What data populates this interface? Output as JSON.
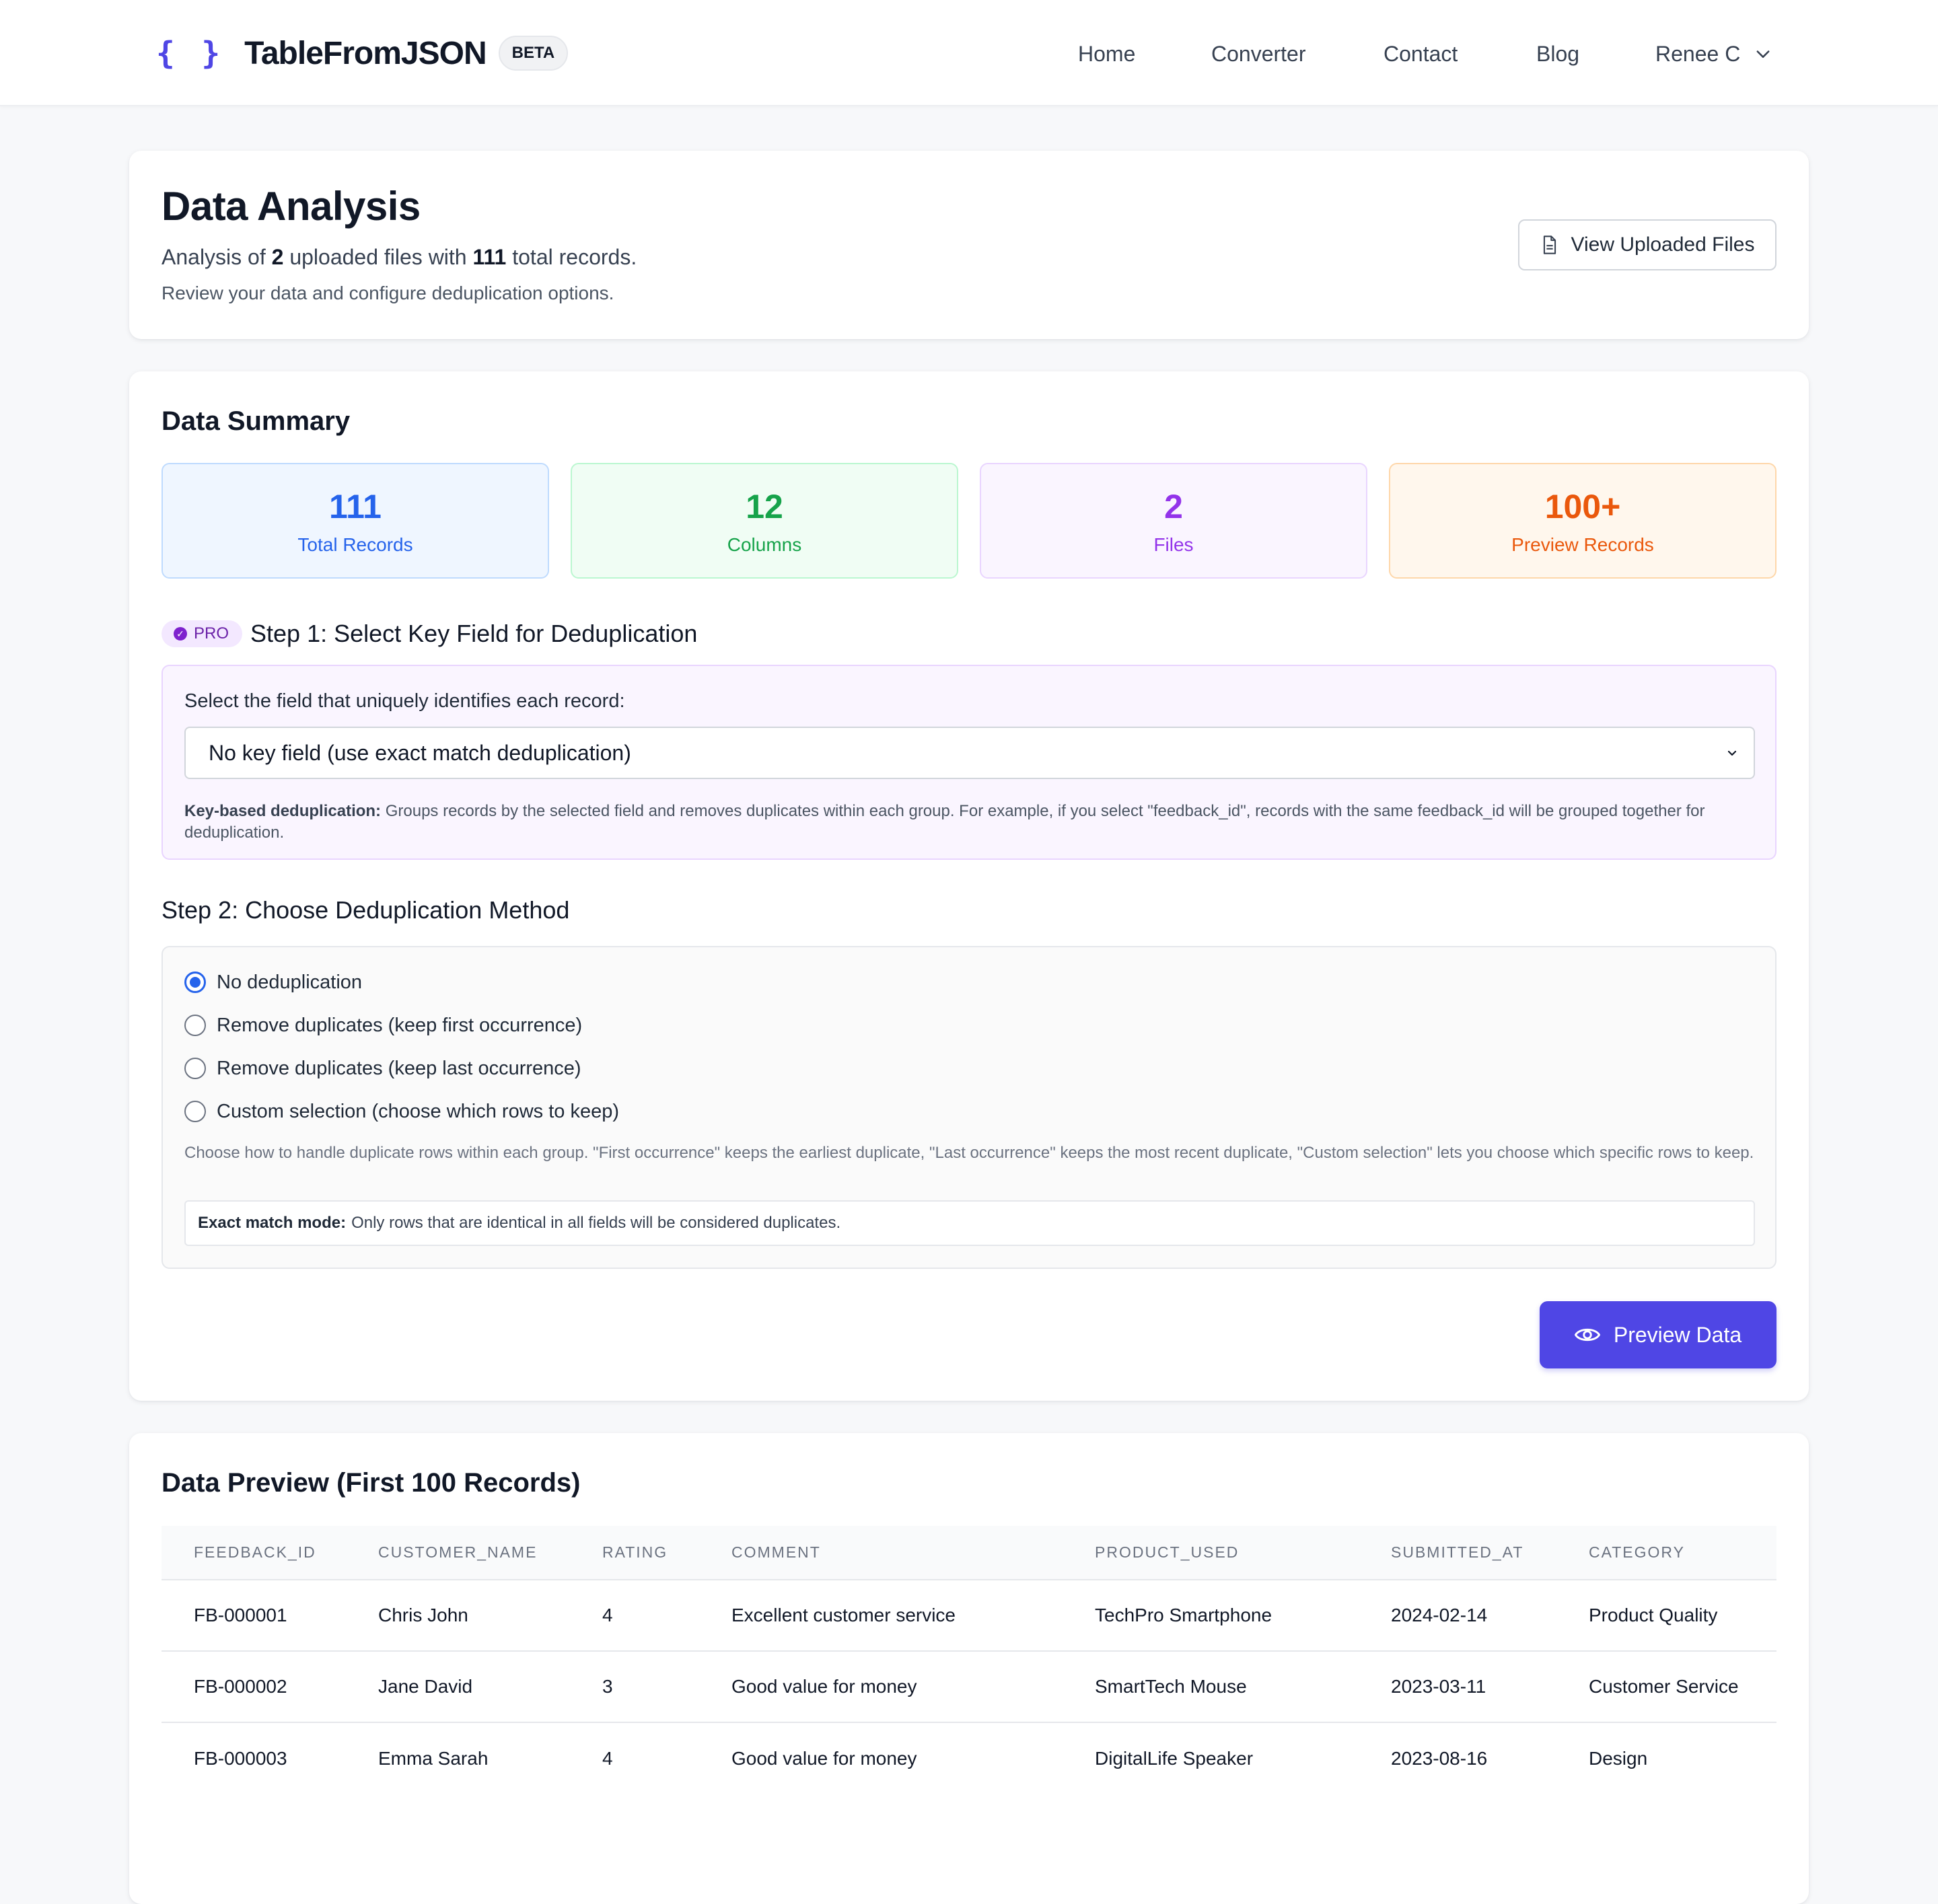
{
  "nav": {
    "logo_glyph": "{ }",
    "brand": "TableFromJSON",
    "badge": "BETA",
    "links": [
      "Home",
      "Converter",
      "Contact",
      "Blog"
    ],
    "user": "Renee C"
  },
  "header": {
    "title": "Data Analysis",
    "sub_prefix": "Analysis of ",
    "files_count": "2",
    "sub_mid": " uploaded files with ",
    "records_count": "111",
    "sub_suffix": " total records.",
    "note": "Review your data and configure deduplication options.",
    "view_files_label": "View Uploaded Files"
  },
  "summary": {
    "title": "Data Summary",
    "stats": [
      {
        "value": "111",
        "label": "Total Records",
        "color": "#2563eb",
        "bg": "#eff6ff",
        "border": "#bfdbfe"
      },
      {
        "value": "12",
        "label": "Columns",
        "color": "#16a34a",
        "bg": "#f0fdf4",
        "border": "#bbf7d0"
      },
      {
        "value": "2",
        "label": "Files",
        "color": "#9333ea",
        "bg": "#faf5ff",
        "border": "#e9d5ff"
      },
      {
        "value": "100+",
        "label": "Preview Records",
        "color": "#ea580c",
        "bg": "#fff7ed",
        "border": "#fed7aa"
      }
    ]
  },
  "step1": {
    "pro_label": "PRO",
    "title": "Step 1: Select Key Field for Deduplication",
    "field_label": "Select the field that uniquely identifies each record:",
    "selected": "No key field (use exact match deduplication)",
    "hint_bold": "Key-based deduplication:",
    "hint_text": " Groups records by the selected field and removes duplicates within each group. For example, if you select \"feedback_id\", records with the same feedback_id will be grouped together for deduplication."
  },
  "step2": {
    "title": "Step 2: Choose Deduplication Method",
    "options": [
      "No deduplication",
      "Remove duplicates (keep first occurrence)",
      "Remove duplicates (keep last occurrence)",
      "Custom selection (choose which rows to keep)"
    ],
    "selected_index": 0,
    "hint": "Choose how to handle duplicate rows within each group. \"First occurrence\" keeps the earliest duplicate, \"Last occurrence\" keeps the most recent duplicate, \"Custom selection\" lets you choose which specific rows to keep.",
    "exact_bold": "Exact match mode:",
    "exact_text": "Only rows that are identical in all fields will be considered duplicates."
  },
  "preview_button": "Preview Data",
  "preview": {
    "title": "Data Preview (First 100 Records)",
    "columns": [
      "FEEDBACK_ID",
      "CUSTOMER_NAME",
      "RATING",
      "COMMENT",
      "PRODUCT_USED",
      "SUBMITTED_AT",
      "CATEGORY"
    ],
    "rows": [
      [
        "FB-000001",
        "Chris John",
        "4",
        "Excellent customer service",
        "TechPro Smartphone",
        "2024-02-14",
        "Product Quality"
      ],
      [
        "FB-000002",
        "Jane David",
        "3",
        "Good value for money",
        "SmartTech Mouse",
        "2023-03-11",
        "Customer Service"
      ],
      [
        "FB-000003",
        "Emma Sarah",
        "4",
        "Good value for money",
        "DigitalLife Speaker",
        "2023-08-16",
        "Design"
      ]
    ]
  },
  "colors": {
    "accent": "#4f46e5",
    "radio": "#2563eb",
    "pro": "#7e22ce"
  }
}
